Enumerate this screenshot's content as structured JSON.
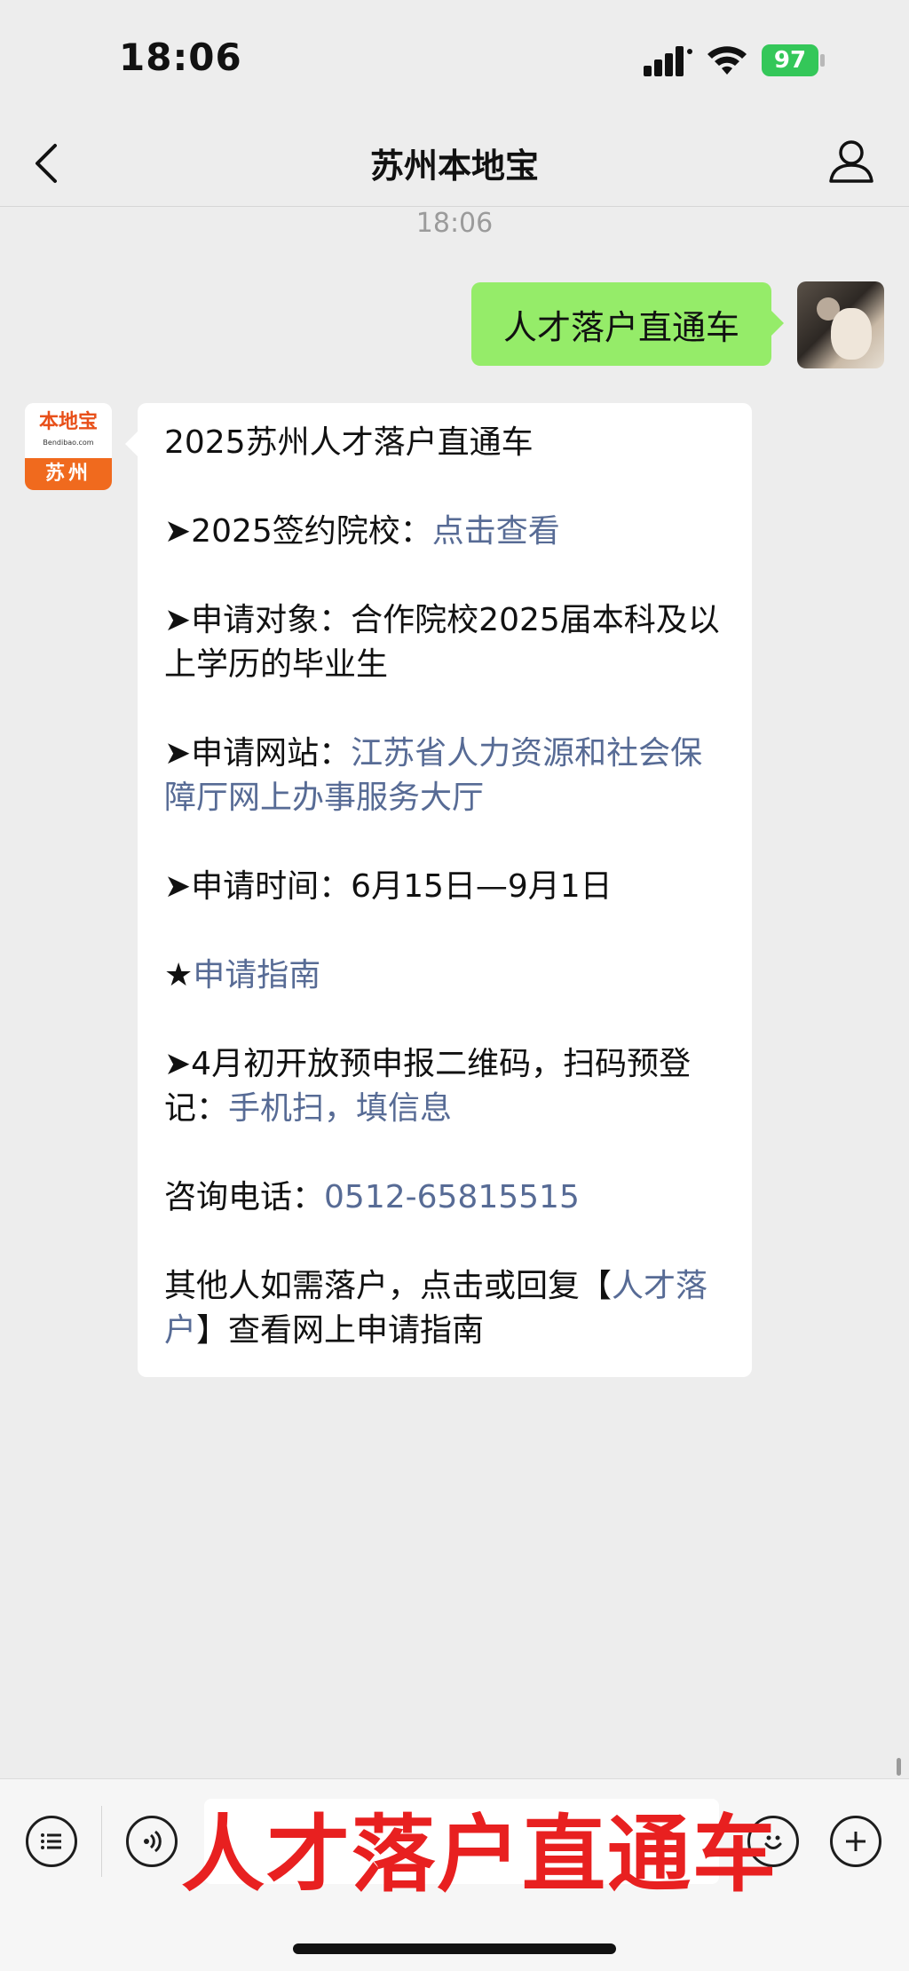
{
  "status_bar": {
    "time": "18:06",
    "battery": "97"
  },
  "nav": {
    "title": "苏州本地宝"
  },
  "chat": {
    "timestamp": "18:06",
    "user_message": "人才落户直通车",
    "bot_avatar": {
      "brand": "本地宝",
      "url": "Bendibao.com",
      "city": "苏州"
    },
    "bot_message": {
      "title": "2025苏州人才落户直通车",
      "schools_prefix": "➤2025签约院校：",
      "schools_link": "点击查看",
      "target": "➤申请对象：合作院校2025届本科及以上学历的毕业生",
      "website_prefix": "➤申请网站：",
      "website_link": "江苏省人力资源和社会保障厅网上办事服务大厅",
      "time": "➤申请时间：6月15日—9月1日",
      "guide_prefix": "★",
      "guide_link": "申请指南",
      "qr_prefix": "➤4月初开放预申报二维码，扫码预登记：",
      "qr_link": "手机扫，填信息",
      "phone_prefix": "咨询电话：",
      "phone_link": "0512-65815515",
      "other_prefix": "其他人如需落户，点击或回复【",
      "other_link": "人才落户",
      "other_suffix": "】查看网上申请指南"
    }
  },
  "input_bar": {
    "overlay_text": "人才落户直通车"
  }
}
